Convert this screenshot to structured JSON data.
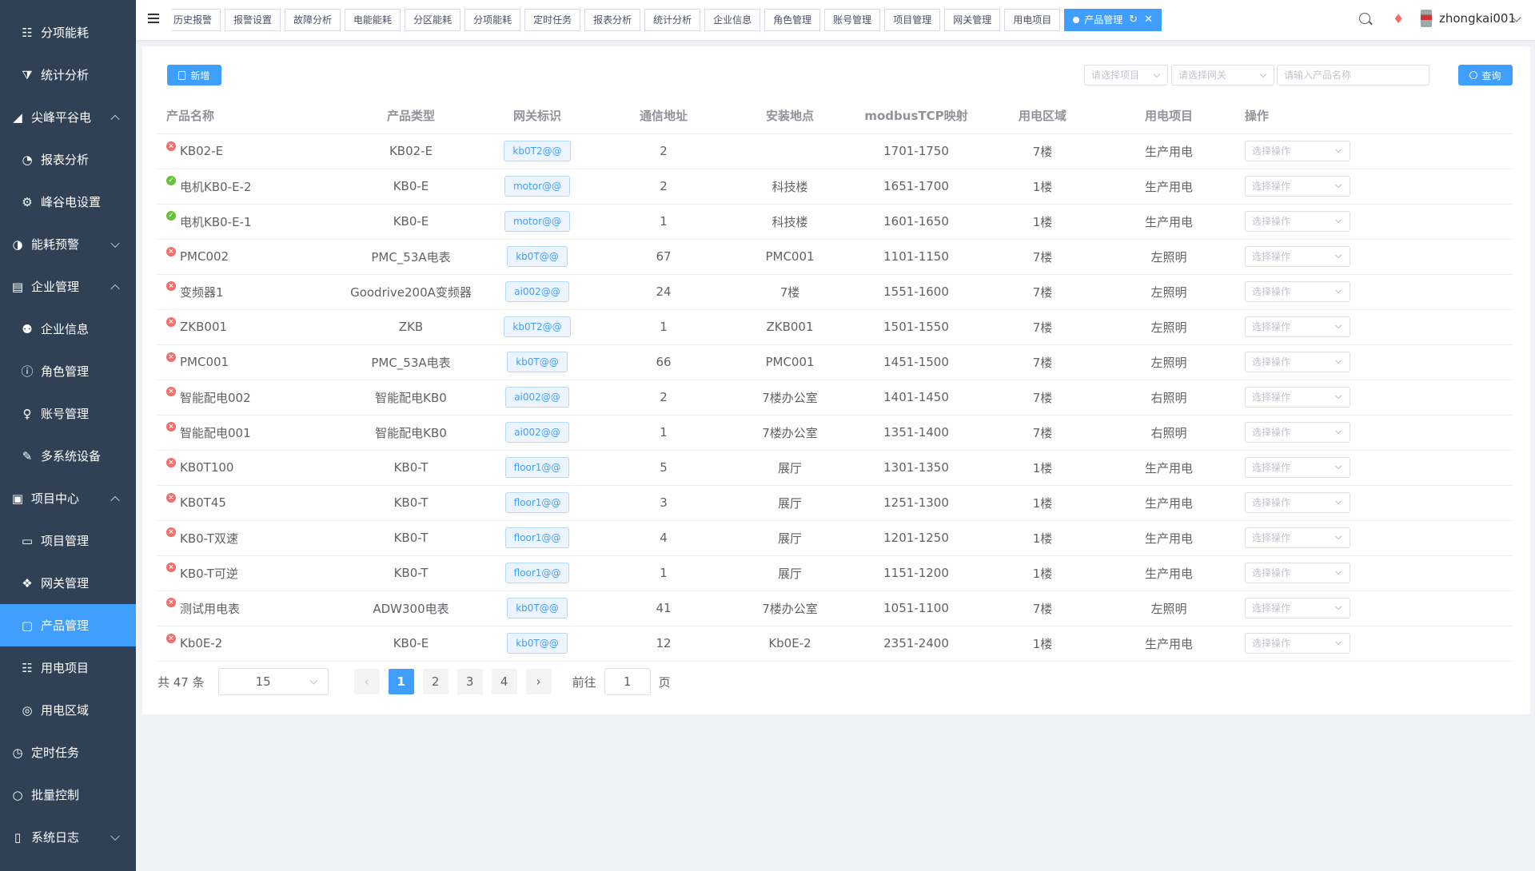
{
  "sidebar": {
    "items": [
      {
        "label": "分项能耗",
        "icon": "sitemap-icon",
        "level": 1,
        "partial": true
      },
      {
        "label": "分项能耗",
        "icon": "sitemap-icon",
        "level": 2
      },
      {
        "label": "统计分析",
        "icon": "funnel-icon",
        "level": 2
      },
      {
        "label": "尖峰平谷电",
        "icon": "area-chart-icon",
        "level": 1,
        "arrow": "up"
      },
      {
        "label": "报表分析",
        "icon": "pie-chart-icon",
        "level": 2
      },
      {
        "label": "峰谷电设置",
        "icon": "settings-icon",
        "level": 2
      },
      {
        "label": "能耗预警",
        "icon": "dashboard-icon",
        "level": 1,
        "arrow": "down"
      },
      {
        "label": "企业管理",
        "icon": "building-icon",
        "level": 1,
        "arrow": "up"
      },
      {
        "label": "企业信息",
        "icon": "handshake-icon",
        "level": 2
      },
      {
        "label": "角色管理",
        "icon": "info-circle-icon",
        "level": 2
      },
      {
        "label": "账号管理",
        "icon": "user-icon",
        "level": 2
      },
      {
        "label": "多系统设备",
        "icon": "plug-icon",
        "level": 2
      },
      {
        "label": "项目中心",
        "icon": "briefcase-icon",
        "level": 1,
        "arrow": "up"
      },
      {
        "label": "项目管理",
        "icon": "suitcase-icon",
        "level": 2
      },
      {
        "label": "网关管理",
        "icon": "dropbox-icon",
        "level": 2
      },
      {
        "label": "产品管理",
        "icon": "product-icon",
        "level": 2,
        "active": true
      },
      {
        "label": "用电项目",
        "icon": "sitemap-icon",
        "level": 2
      },
      {
        "label": "用电区域",
        "icon": "location-pin-icon",
        "level": 2
      },
      {
        "label": "定时任务",
        "icon": "clock-icon",
        "level": 1
      },
      {
        "label": "批量控制",
        "icon": "toggle-icon",
        "level": 1
      },
      {
        "label": "系统日志",
        "icon": "document-icon",
        "level": 1,
        "arrow": "down"
      }
    ]
  },
  "topbar": {
    "tabs": [
      "历史报警",
      "报警设置",
      "故障分析",
      "电能能耗",
      "分区能耗",
      "分项能耗",
      "定时任务",
      "报表分析",
      "统计分析",
      "企业信息",
      "角色管理",
      "账号管理",
      "项目管理",
      "网关管理",
      "用电项目"
    ],
    "active_tab": "产品管理",
    "username": "zhongkai001"
  },
  "toolbar": {
    "add_label": "新增",
    "project_placeholder": "请选择项目",
    "gateway_placeholder": "请选择网关",
    "product_name_placeholder": "请输入产品名称",
    "query_label": "查询"
  },
  "table": {
    "columns": [
      "产品名称",
      "产品类型",
      "网关标识",
      "通信地址",
      "安装地点",
      "modbusTCP映射",
      "用电区域",
      "用电项目",
      "操作"
    ],
    "action_placeholder": "选择操作",
    "rows": [
      {
        "status": "offline",
        "name": "KB02-E",
        "type": "KB02-E",
        "gateway": "kb0T2@@",
        "address": "2",
        "location": "",
        "mapping": "1701-1750",
        "area": "7楼",
        "project": "生产用电"
      },
      {
        "status": "online",
        "name": "电机KB0-E-2",
        "type": "KB0-E",
        "gateway": "motor@@",
        "address": "2",
        "location": "科技楼",
        "mapping": "1651-1700",
        "area": "1楼",
        "project": "生产用电"
      },
      {
        "status": "online",
        "name": "电机KB0-E-1",
        "type": "KB0-E",
        "gateway": "motor@@",
        "address": "1",
        "location": "科技楼",
        "mapping": "1601-1650",
        "area": "1楼",
        "project": "生产用电"
      },
      {
        "status": "offline",
        "name": "PMC002",
        "type": "PMC_53A电表",
        "gateway": "kb0T@@",
        "address": "67",
        "location": "PMC001",
        "mapping": "1101-1150",
        "area": "7楼",
        "project": "左照明"
      },
      {
        "status": "offline",
        "name": "变频器1",
        "type": "Goodrive200A变频器",
        "gateway": "ai002@@",
        "address": "24",
        "location": "7楼",
        "mapping": "1551-1600",
        "area": "7楼",
        "project": "左照明"
      },
      {
        "status": "offline",
        "name": "ZKB001",
        "type": "ZKB",
        "gateway": "kb0T2@@",
        "address": "1",
        "location": "ZKB001",
        "mapping": "1501-1550",
        "area": "7楼",
        "project": "左照明"
      },
      {
        "status": "offline",
        "name": "PMC001",
        "type": "PMC_53A电表",
        "gateway": "kb0T@@",
        "address": "66",
        "location": "PMC001",
        "mapping": "1451-1500",
        "area": "7楼",
        "project": "左照明"
      },
      {
        "status": "offline",
        "name": "智能配电002",
        "type": "智能配电KB0",
        "gateway": "ai002@@",
        "address": "2",
        "location": "7楼办公室",
        "mapping": "1401-1450",
        "area": "7楼",
        "project": "右照明"
      },
      {
        "status": "offline",
        "name": "智能配电001",
        "type": "智能配电KB0",
        "gateway": "ai002@@",
        "address": "1",
        "location": "7楼办公室",
        "mapping": "1351-1400",
        "area": "7楼",
        "project": "右照明"
      },
      {
        "status": "offline",
        "name": "KB0T100",
        "type": "KB0-T",
        "gateway": "floor1@@",
        "address": "5",
        "location": "展厅",
        "mapping": "1301-1350",
        "area": "1楼",
        "project": "生产用电"
      },
      {
        "status": "offline",
        "name": "KB0T45",
        "type": "KB0-T",
        "gateway": "floor1@@",
        "address": "3",
        "location": "展厅",
        "mapping": "1251-1300",
        "area": "1楼",
        "project": "生产用电"
      },
      {
        "status": "offline",
        "name": "KB0-T双速",
        "type": "KB0-T",
        "gateway": "floor1@@",
        "address": "4",
        "location": "展厅",
        "mapping": "1201-1250",
        "area": "1楼",
        "project": "生产用电"
      },
      {
        "status": "offline",
        "name": "KB0-T可逆",
        "type": "KB0-T",
        "gateway": "floor1@@",
        "address": "1",
        "location": "展厅",
        "mapping": "1151-1200",
        "area": "1楼",
        "project": "生产用电"
      },
      {
        "status": "offline",
        "name": "测试用电表",
        "type": "ADW300电表",
        "gateway": "kb0T@@",
        "address": "41",
        "location": "7楼办公室",
        "mapping": "1051-1100",
        "area": "7楼",
        "project": "左照明"
      },
      {
        "status": "offline",
        "name": "Kb0E-2",
        "type": "KB0-E",
        "gateway": "kb0T@@",
        "address": "12",
        "location": "Kb0E-2",
        "mapping": "2351-2400",
        "area": "1楼",
        "project": "生产用电"
      }
    ]
  },
  "pagination": {
    "total_text": "共 47 条",
    "page_size": "15",
    "pages": [
      "1",
      "2",
      "3",
      "4"
    ],
    "current_page": "1",
    "goto_label": "前往",
    "goto_value": "1",
    "page_suffix": "页"
  },
  "colors": {
    "sidebar_bg": "#304156",
    "primary": "#409eff",
    "offline": "#f56c6c",
    "online": "#67c23a"
  }
}
